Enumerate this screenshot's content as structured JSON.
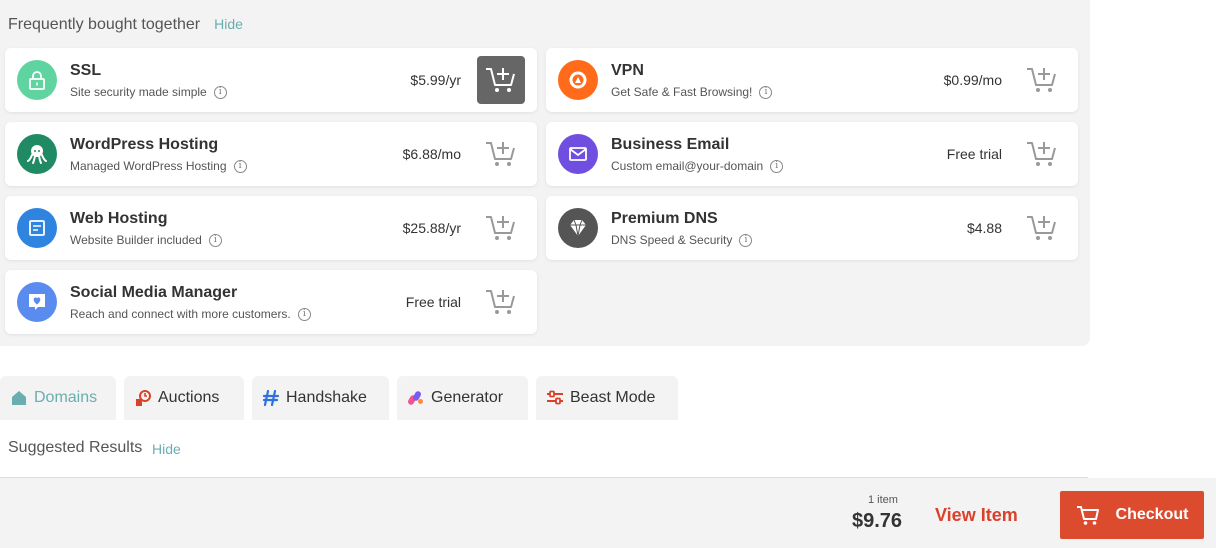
{
  "fbt": {
    "title": "Frequently bought together",
    "hide": "Hide",
    "products": [
      {
        "name": "SSL",
        "desc": "Site security made simple",
        "price": "$5.99/yr",
        "icon": "lock-icon",
        "color": "#5fd4a0",
        "in_cart": true
      },
      {
        "name": "VPN",
        "desc": "Get Safe & Fast Browsing!",
        "price": "$0.99/mo",
        "icon": "vpn-logo-icon",
        "color": "#ff6b1a",
        "in_cart": false
      },
      {
        "name": "WordPress Hosting",
        "desc": "Managed WordPress Hosting",
        "price": "$6.88/mo",
        "icon": "octopus-icon",
        "color": "#1f8a64",
        "in_cart": false
      },
      {
        "name": "Business Email",
        "desc": "Custom email@your-domain",
        "price": "Free trial",
        "icon": "envelope-icon",
        "color": "#6f4ee0",
        "in_cart": false
      },
      {
        "name": "Web Hosting",
        "desc": "Website Builder included",
        "price": "$25.88/yr",
        "icon": "browser-window-icon",
        "color": "#2f84e0",
        "in_cart": false
      },
      {
        "name": "Premium DNS",
        "desc": "DNS Speed & Security",
        "price": "$4.88",
        "icon": "diamond-icon",
        "color": "#555555",
        "in_cart": false
      },
      {
        "name": "Social Media Manager",
        "desc": "Reach and connect with more customers.",
        "price": "Free trial",
        "icon": "heart-chat-icon",
        "color": "#5a8cf0",
        "in_cart": false
      }
    ]
  },
  "tabs": [
    {
      "label": "Domains",
      "icon": "home-icon",
      "active": true
    },
    {
      "label": "Auctions",
      "icon": "auction-clock-icon",
      "active": false
    },
    {
      "label": "Handshake",
      "icon": "handshake-logo-icon",
      "active": false
    },
    {
      "label": "Generator",
      "icon": "generator-icon",
      "active": false
    },
    {
      "label": "Beast Mode",
      "icon": "sliders-icon",
      "active": false
    }
  ],
  "suggested": {
    "title": "Suggested Results",
    "hide": "Hide"
  },
  "footer": {
    "count": "1 item",
    "total": "$9.76",
    "view_item": "View Item",
    "checkout": "Checkout"
  },
  "colors": {
    "accent": "#6aaeb0",
    "brand": "#dd4b2f",
    "panel": "#f3f3f3"
  }
}
